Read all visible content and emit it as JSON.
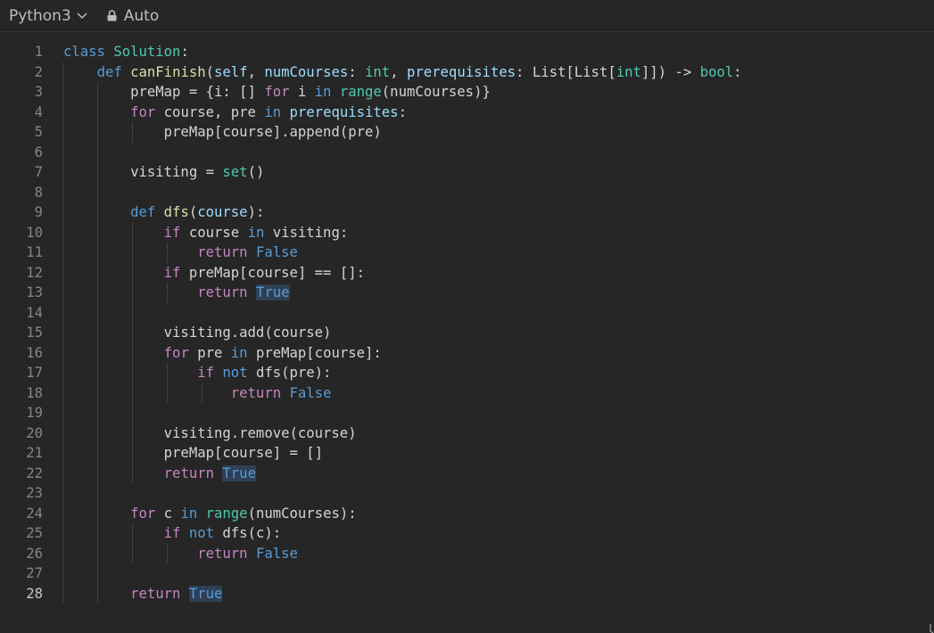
{
  "toolbar": {
    "language": "Python3",
    "mode": "Auto"
  },
  "editor": {
    "active_line": 28,
    "lines": [
      "class Solution:",
      "    def canFinish(self, numCourses: int, prerequisites: List[List[int]]) -> bool:",
      "        preMap = {i: [] for i in range(numCourses)}",
      "        for course, pre in prerequisites:",
      "            preMap[course].append(pre)",
      "",
      "        visiting = set()",
      "",
      "        def dfs(course):",
      "            if course in visiting:",
      "                return False",
      "            if preMap[course] == []:",
      "                return True",
      "",
      "            visiting.add(course)",
      "            for pre in preMap[course]:",
      "                if not dfs(pre):",
      "                    return False",
      "",
      "            visiting.remove(course)",
      "            preMap[course] = []",
      "            return True",
      "",
      "        for c in range(numCourses):",
      "            if not dfs(c):",
      "                return False",
      "",
      "        return True"
    ]
  },
  "colors": {
    "background": "#262626",
    "keyword": "#c586c0",
    "builtin_keyword": "#569cd6",
    "type": "#4ec9b0",
    "function": "#dcdcaa",
    "parameter": "#9cdcfe"
  }
}
